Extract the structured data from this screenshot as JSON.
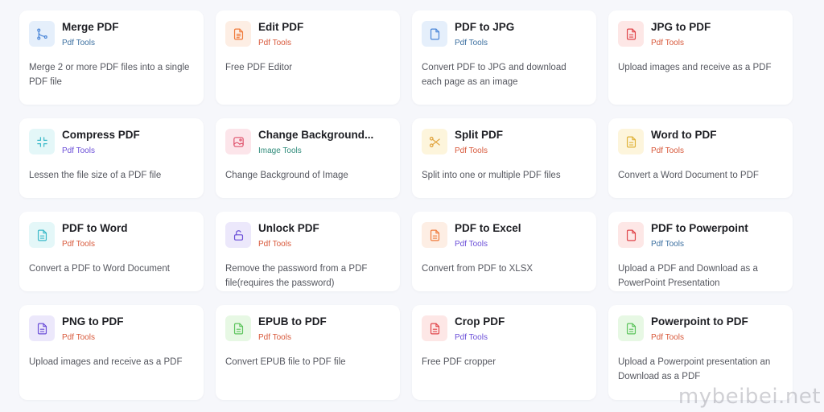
{
  "tools": [
    {
      "title": "Merge PDF",
      "category": "Pdf Tools",
      "category_color": "#3b6fa0",
      "description": "Merge 2 or more PDF files into a single PDF file",
      "icon": "merge-icon",
      "icon_color": "#4a86d8",
      "icon_bg": "#e5effb"
    },
    {
      "title": "Edit PDF",
      "category": "Pdf Tools",
      "category_color": "#d8593b",
      "description": "Free PDF Editor",
      "icon": "edit-document-icon",
      "icon_color": "#f07b3c",
      "icon_bg": "#fdeee4"
    },
    {
      "title": "PDF to JPG",
      "category": "Pdf Tools",
      "category_color": "#3b6fa0",
      "description": "Convert PDF to JPG and download each page as an image",
      "icon": "file-icon",
      "icon_color": "#4a86d8",
      "icon_bg": "#e5effb"
    },
    {
      "title": "JPG to PDF",
      "category": "Pdf Tools",
      "category_color": "#d8593b",
      "description": "Upload images and receive as a PDF",
      "icon": "document-icon",
      "icon_color": "#e0454a",
      "icon_bg": "#fde7e6"
    },
    {
      "title": "Compress PDF",
      "category": "Pdf Tools",
      "category_color": "#6b4fd8",
      "description": "Lessen the file size of a PDF file",
      "icon": "compress-icon",
      "icon_color": "#3ab9c9",
      "icon_bg": "#e4f7f8"
    },
    {
      "title": "Change Background...",
      "category": "Image Tools",
      "category_color": "#2f8b7a",
      "description": "Change Background of Image",
      "icon": "image-icon",
      "icon_color": "#e0546e",
      "icon_bg": "#fce5ea"
    },
    {
      "title": "Split PDF",
      "category": "Pdf Tools",
      "category_color": "#d8593b",
      "description": "Split into one or multiple PDF files",
      "icon": "scissors-icon",
      "icon_color": "#e0a23a",
      "icon_bg": "#fdf5dc"
    },
    {
      "title": "Word to PDF",
      "category": "Pdf Tools",
      "category_color": "#d8593b",
      "description": "Convert a Word Document to PDF",
      "icon": "document-icon",
      "icon_color": "#e0b33a",
      "icon_bg": "#fdf5dc"
    },
    {
      "title": "PDF to Word",
      "category": "Pdf Tools",
      "category_color": "#d8593b",
      "description": "Convert a PDF to Word Document",
      "icon": "document-icon",
      "icon_color": "#3ab9c9",
      "icon_bg": "#e4f7f8"
    },
    {
      "title": "Unlock PDF",
      "category": "Pdf Tools",
      "category_color": "#d8593b",
      "description": "Remove the password from a PDF file(requires the password)",
      "icon": "unlock-icon",
      "icon_color": "#6b4fd8",
      "icon_bg": "#ece8fb"
    },
    {
      "title": "PDF to Excel",
      "category": "Pdf Tools",
      "category_color": "#6b4fd8",
      "description": "Convert from PDF to XLSX",
      "icon": "document-icon",
      "icon_color": "#f07b3c",
      "icon_bg": "#fdeee4"
    },
    {
      "title": "PDF to Powerpoint",
      "category": "Pdf Tools",
      "category_color": "#3b6fa0",
      "description": "Upload a PDF and Download as a PowerPoint Presentation",
      "icon": "file-icon",
      "icon_color": "#e0454a",
      "icon_bg": "#fde7e6"
    },
    {
      "title": "PNG to PDF",
      "category": "Pdf Tools",
      "category_color": "#d8593b",
      "description": "Upload images and receive as a PDF",
      "icon": "document-icon",
      "icon_color": "#6b4fd8",
      "icon_bg": "#ece8fb"
    },
    {
      "title": "EPUB to PDF",
      "category": "Pdf Tools",
      "category_color": "#d8593b",
      "description": "Convert EPUB file to PDF file",
      "icon": "document-icon",
      "icon_color": "#5cc45c",
      "icon_bg": "#e7f8e4"
    },
    {
      "title": "Crop PDF",
      "category": "Pdf Tools",
      "category_color": "#6b4fd8",
      "description": "Free PDF cropper",
      "icon": "document-icon",
      "icon_color": "#e0454a",
      "icon_bg": "#fde7e6"
    },
    {
      "title": "Powerpoint to PDF",
      "category": "Pdf Tools",
      "category_color": "#d8593b",
      "description": "Upload a Powerpoint presentation an Download as a PDF",
      "icon": "document-icon",
      "icon_color": "#5cc45c",
      "icon_bg": "#e7f8e4"
    }
  ],
  "watermark": "mybeibei.net"
}
